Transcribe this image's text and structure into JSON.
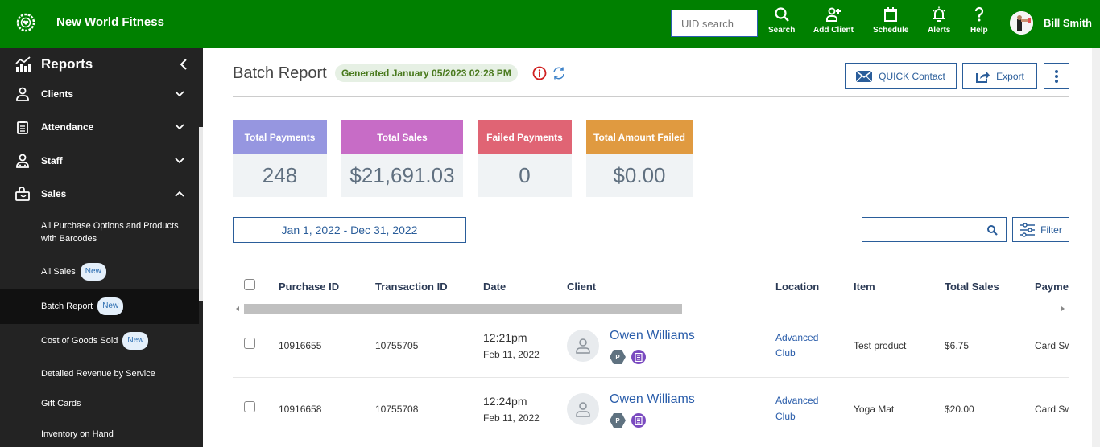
{
  "app": {
    "brand_name": "New World Fitness",
    "uid_search_placeholder": "UID search",
    "nav": [
      {
        "label": "Search",
        "icon": "search-icon"
      },
      {
        "label": "Add Client",
        "icon": "add-user-icon"
      },
      {
        "label": "Schedule",
        "icon": "calendar-icon"
      },
      {
        "label": "Alerts",
        "icon": "bell-icon"
      },
      {
        "label": "Help",
        "icon": "question-icon"
      }
    ],
    "user_name": "Bill Smith",
    "brand_color": "#008000"
  },
  "sidebar": {
    "header": "Reports",
    "sections": [
      {
        "label": "Clients",
        "icon": "user-icon",
        "expanded": false
      },
      {
        "label": "Attendance",
        "icon": "clipboard-icon",
        "expanded": false
      },
      {
        "label": "Staff",
        "icon": "staff-icon",
        "expanded": false
      },
      {
        "label": "Sales",
        "icon": "bag-icon",
        "expanded": true
      }
    ],
    "sales_items": [
      {
        "label": "All Purchase Options and Products with Barcodes",
        "new": false,
        "active": false
      },
      {
        "label": "All Sales",
        "new": true,
        "active": false
      },
      {
        "label": "Batch Report",
        "new": true,
        "active": true
      },
      {
        "label": "Cost of Goods Sold",
        "new": true,
        "active": false
      },
      {
        "label": "Detailed Revenue by Service",
        "new": false,
        "active": false
      },
      {
        "label": "Gift Cards",
        "new": false,
        "active": false
      },
      {
        "label": "Inventory on Hand",
        "new": false,
        "active": false
      }
    ],
    "new_badge": "New"
  },
  "page": {
    "title": "Batch Report",
    "generated": "Generated January 05/2023 02:28 PM",
    "quick_contact": "QUICK Contact",
    "export": "Export"
  },
  "stats": [
    {
      "label": "Total Payments",
      "value": "248",
      "color": "#9696e0"
    },
    {
      "label": "Total Sales",
      "value": "$21,691.03",
      "color": "#c76cc6"
    },
    {
      "label": "Failed Payments",
      "value": "0",
      "color": "#e06474"
    },
    {
      "label": "Total Amount Failed",
      "value": "$0.00",
      "color": "#e09a40"
    }
  ],
  "filters": {
    "date_range": "Jan 1, 2022 - Dec 31, 2022",
    "search_value": "",
    "filter_label": "Filter"
  },
  "table": {
    "columns": [
      "Purchase ID",
      "Transaction ID",
      "Date",
      "Client",
      "Location",
      "Item",
      "Total Sales",
      "Payme"
    ],
    "rows": [
      {
        "purchase_id": "10916655",
        "transaction_id": "10755705",
        "time": "12:21pm",
        "date": "Feb 11, 2022",
        "client": "Owen Williams",
        "badge_letter": "P",
        "location_line1": "Advanced",
        "location_line2": "Club",
        "item": "Test product",
        "total": "$6.75",
        "payment": "Card Sw"
      },
      {
        "purchase_id": "10916658",
        "transaction_id": "10755708",
        "time": "12:24pm",
        "date": "Feb 11, 2022",
        "client": "Owen Williams",
        "badge_letter": "P",
        "location_line1": "Advanced",
        "location_line2": "Club",
        "item": "Yoga Mat",
        "total": "$20.00",
        "payment": "Card Sw"
      }
    ]
  }
}
